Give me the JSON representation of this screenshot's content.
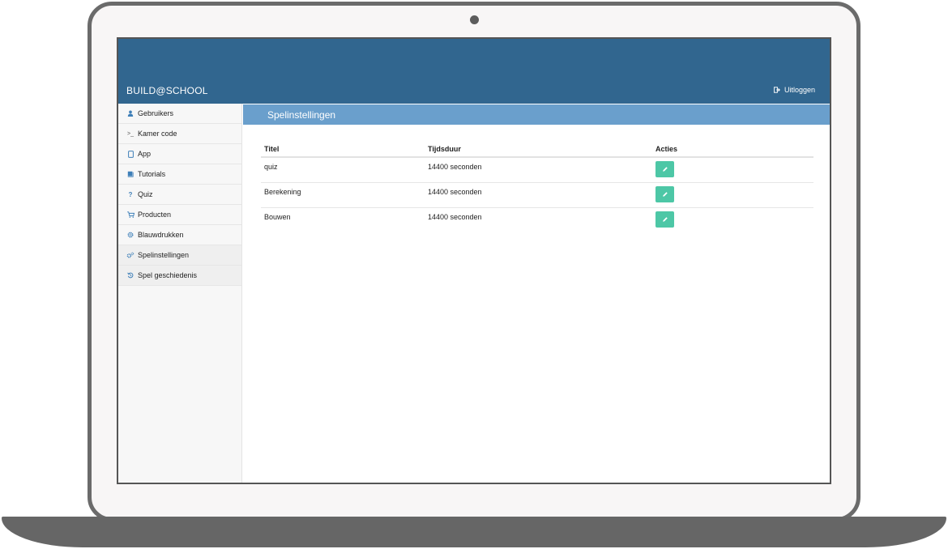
{
  "app": {
    "brand": "BUILD@SCHOOL",
    "logout_label": "Uitloggen"
  },
  "sidebar": {
    "items": [
      {
        "icon": "user-icon",
        "glyph": "👤",
        "label": "Gebruikers"
      },
      {
        "icon": "terminal-icon",
        "glyph": ">_",
        "label": "Kamer code"
      },
      {
        "icon": "phone-icon",
        "glyph": "▯",
        "label": "App"
      },
      {
        "icon": "book-icon",
        "glyph": "📘",
        "label": "Tutorials"
      },
      {
        "icon": "question-icon",
        "glyph": "?",
        "label": "Quiz"
      },
      {
        "icon": "cart-icon",
        "glyph": "🛒",
        "label": "Producten"
      },
      {
        "icon": "gear-icon",
        "glyph": "⚙",
        "label": "Blauwdrukken"
      },
      {
        "icon": "gears-icon",
        "glyph": "⚙",
        "label": "Spelinstellingen"
      },
      {
        "icon": "history-icon",
        "glyph": "↺",
        "label": "Spel geschiedenis"
      }
    ]
  },
  "main": {
    "title": "Spelinstellingen",
    "table": {
      "headers": [
        "Titel",
        "Tijdsduur",
        "Acties"
      ],
      "rows": [
        {
          "title": "quiz",
          "duration": "14400 seconden"
        },
        {
          "title": "Berekening",
          "duration": "14400 seconden"
        },
        {
          "title": "Bouwen",
          "duration": "14400 seconden"
        }
      ]
    }
  },
  "colors": {
    "topbar": "#31668f",
    "header_bar": "#6a9fcc",
    "action_button": "#4dc7a6",
    "sidebar_icon": "#3e7fb8"
  }
}
